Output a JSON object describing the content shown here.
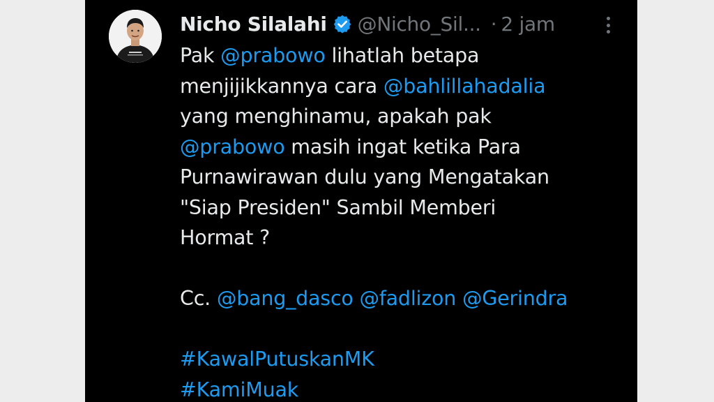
{
  "tweet": {
    "display_name": "Nicho Silalahi",
    "handle": "@Nicho_Sil...",
    "separator": "·",
    "time": "2 jam",
    "verified_icon": "verified-badge-icon",
    "more_icon": "more-options-icon",
    "avatar_icon": "profile-avatar",
    "colors": {
      "background": "#000000",
      "text": "#e7e9ea",
      "muted": "#71767b",
      "link": "#1d9bf0"
    },
    "body": {
      "l1_a": "Pak ",
      "l1_m1": "@prabowo",
      "l1_b": " lihatlah betapa",
      "l2_a": "menjijikkannya cara ",
      "l2_m1": "@bahlillahadalia",
      "l3": "yang menghinamu, apakah pak",
      "l4_m1": "@prabowo",
      "l4_b": " masih ingat ketika Para",
      "l5": "Purnawirawan dulu yang Mengatakan",
      "l6": "\"Siap Presiden\" Sambil Memberi",
      "l7": "Hormat ?",
      "cc_label": "Cc. ",
      "cc_m1": "@bang_dasco",
      "cc_m2": "@fadlizon",
      "cc_m3": "@Gerindra",
      "hashtag1": "#KawalPutuskanMK",
      "hashtag2": "#KamiMuak"
    }
  }
}
